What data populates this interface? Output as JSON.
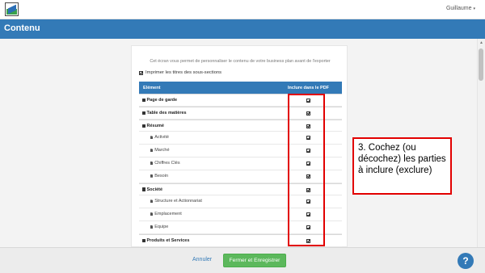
{
  "topbar": {
    "user_name": "Guillaume",
    "user_caret": "▾"
  },
  "header": {
    "title": "Contenu"
  },
  "intro": {
    "text": "Cet écran vous permet de personnaliser le contenu de votre business plan avant de l'exporter"
  },
  "print_titles": {
    "label": "Imprimer les titres des sous-sections",
    "checked": true
  },
  "table": {
    "col_element": "Elément",
    "col_include": "Inclure dans le PDF",
    "rows": [
      {
        "label": "Page de garde",
        "kind": "section",
        "checked": true
      },
      {
        "label": "Table des matières",
        "kind": "section",
        "checked": true
      },
      {
        "label": "Résumé",
        "kind": "section",
        "checked": true
      },
      {
        "label": "Activité",
        "kind": "sub",
        "checked": true
      },
      {
        "label": "Marché",
        "kind": "sub",
        "checked": true
      },
      {
        "label": "Chiffres Clés",
        "kind": "sub",
        "checked": true
      },
      {
        "label": "Besoin",
        "kind": "sub",
        "checked": true
      },
      {
        "label": "Société",
        "kind": "section",
        "checked": true
      },
      {
        "label": "Structure et Actionnariat",
        "kind": "sub",
        "checked": true
      },
      {
        "label": "Emplacement",
        "kind": "sub",
        "checked": true
      },
      {
        "label": "Equipe",
        "kind": "sub",
        "checked": true
      },
      {
        "label": "Produits et Services",
        "kind": "section",
        "checked": true
      }
    ]
  },
  "callout": {
    "text": "3. Cochez (ou décochez) les parties à inclure (exclure)"
  },
  "footer": {
    "cancel_label": "Annuler",
    "save_label": "Fermer et Enregistrer",
    "help_label": "?"
  },
  "colors": {
    "primary": "#337ab7",
    "success": "#5cb85c",
    "highlight": "#e20000"
  },
  "icons": {
    "section": "book-icon",
    "subsection": "document-icon"
  }
}
